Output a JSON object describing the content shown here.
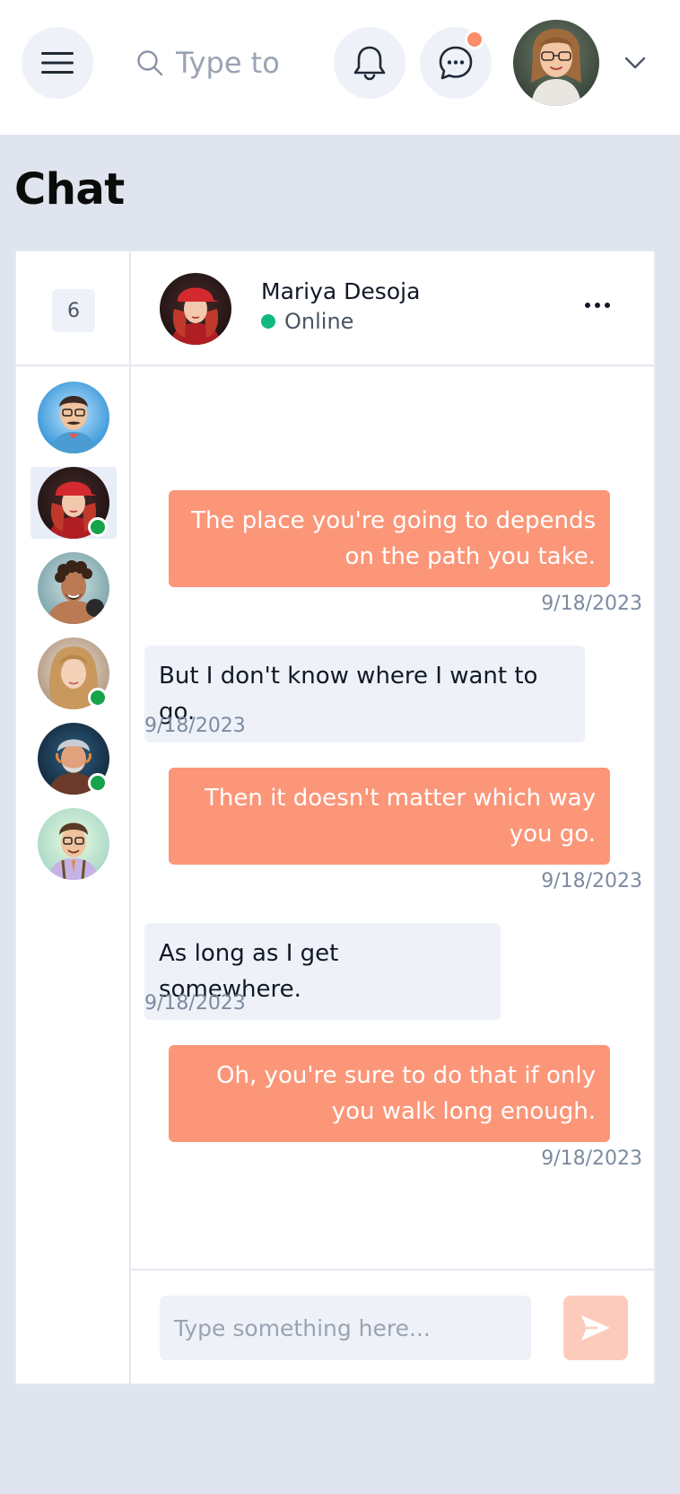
{
  "topbar": {
    "search_placeholder": "Type to",
    "notifications_icon": "bell-icon",
    "messages_icon": "chat-bubble-icon",
    "messages_badge_color": "#fb8c6c",
    "menu_icon": "hamburger-icon",
    "user_menu_icon": "chevron-down-icon"
  },
  "page": {
    "title": "Chat"
  },
  "contacts": {
    "count": "6",
    "items": [
      {
        "avatar": "man-with-glasses-bowtie",
        "online": false,
        "active": false
      },
      {
        "avatar": "woman-red-cap",
        "online": true,
        "active": true
      },
      {
        "avatar": "man-curly-hair",
        "online": false,
        "active": false
      },
      {
        "avatar": "woman-blonde",
        "online": true,
        "active": false
      },
      {
        "avatar": "old-man-beard",
        "online": true,
        "active": false
      },
      {
        "avatar": "man-glasses-suspenders",
        "online": false,
        "active": false
      }
    ]
  },
  "conversation": {
    "name": "Mariya Desoja",
    "status": "Online",
    "status_color": "#10b981",
    "messages": [
      {
        "direction": "out",
        "text": "The place you're going to depends on the path you take.",
        "date": "9/18/2023"
      },
      {
        "direction": "in",
        "text": "But I don't know where I want to go.",
        "date": "9/18/2023"
      },
      {
        "direction": "out",
        "text": "Then it doesn't matter which way you go.",
        "date": "9/18/2023"
      },
      {
        "direction": "in",
        "text": "As long as I get somewhere.",
        "date": "9/18/2023"
      },
      {
        "direction": "out",
        "text": "Oh, you're sure to do that if only you walk long enough.",
        "date": "9/18/2023"
      }
    ]
  },
  "composer": {
    "placeholder": "Type something here...",
    "send_icon": "send-icon"
  },
  "colors": {
    "accent": "#fb9679",
    "background": "#dfe4ee",
    "online": "#16a34a"
  }
}
